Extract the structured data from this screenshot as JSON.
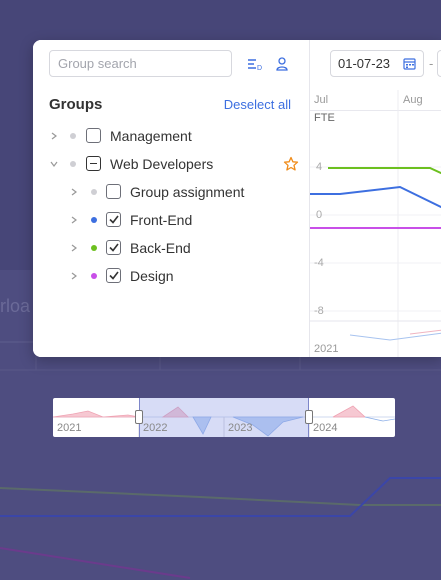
{
  "search": {
    "placeholder": "Group search"
  },
  "groups": {
    "title": "Groups",
    "deselect_label": "Deselect all",
    "items": [
      {
        "label": "Management",
        "expanded": false,
        "checked": "unchecked",
        "dot_color": "#cfcfd4"
      },
      {
        "label": "Web Developers",
        "expanded": true,
        "checked": "indeterminate",
        "dot_color": "#cfcfd4",
        "favorite": true
      },
      {
        "label": "Group assignment",
        "expanded": false,
        "checked": "unchecked",
        "dot_color": "#cfcfd4"
      },
      {
        "label": "Front-End",
        "expanded": false,
        "checked": "checked",
        "dot_color": "#3d6fe0"
      },
      {
        "label": "Back-End",
        "expanded": false,
        "checked": "checked",
        "dot_color": "#6cc01f"
      },
      {
        "label": "Design",
        "expanded": false,
        "checked": "checked",
        "dot_color": "#c84fe8"
      }
    ]
  },
  "date_range": {
    "start": "01-07-23",
    "separator": "-"
  },
  "chart": {
    "months": [
      "Jul",
      "Aug"
    ],
    "unit_label": "FTE",
    "yticks": [
      "4",
      "0",
      "-4",
      "-8"
    ],
    "year_label": "2021"
  },
  "timeline": {
    "years": [
      "2021",
      "2022",
      "2023",
      "2024"
    ]
  },
  "colors": {
    "accent": "#3d6fe0",
    "frontend": "#3d6fe0",
    "backend": "#6cc01f",
    "design": "#c84fe8",
    "star": "#f08c1a"
  }
}
